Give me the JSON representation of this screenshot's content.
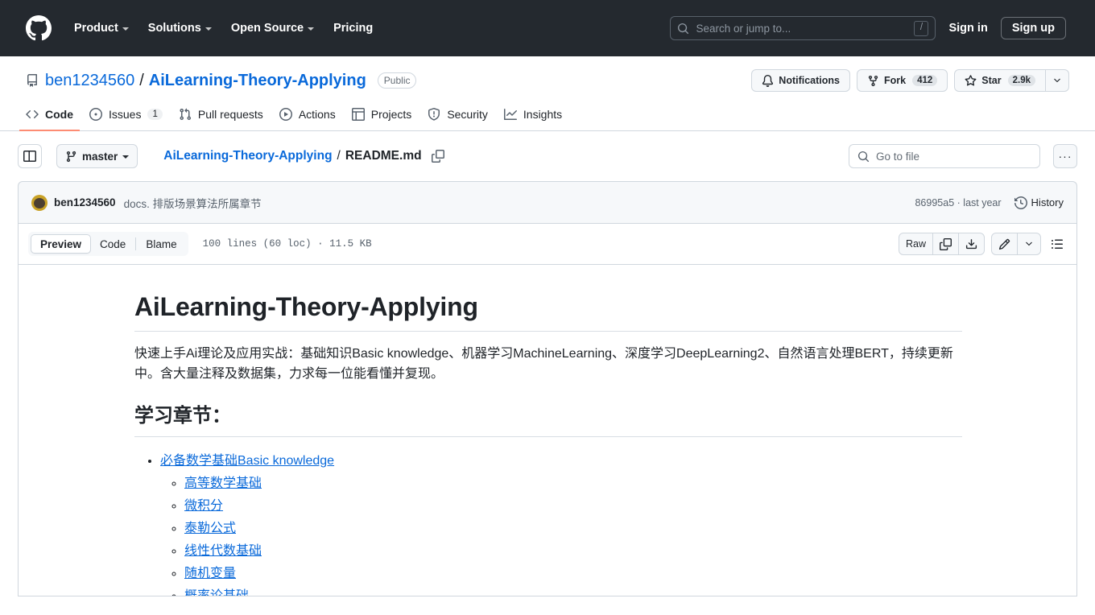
{
  "header": {
    "logo_icon": "github-mark-icon",
    "nav": [
      {
        "label": "Product",
        "has_chevron": true
      },
      {
        "label": "Solutions",
        "has_chevron": true
      },
      {
        "label": "Open Source",
        "has_chevron": true
      },
      {
        "label": "Pricing",
        "has_chevron": false
      }
    ],
    "search": {
      "placeholder": "Search or jump to...",
      "shortcut": "/",
      "icon": "search-icon"
    },
    "sign_in": "Sign in",
    "sign_up": "Sign up"
  },
  "repo": {
    "owner": "ben1234560",
    "separator": "/",
    "name": "AiLearning-Theory-Applying",
    "visibility": "Public",
    "repo_icon": "repo-icon",
    "actions": {
      "notifications": {
        "label": "Notifications",
        "icon": "bell-icon"
      },
      "fork": {
        "label": "Fork",
        "count": "412",
        "icon": "fork-icon"
      },
      "star": {
        "label": "Star",
        "count": "2.9k",
        "icon": "star-icon"
      },
      "star_dropdown_icon": "chevron-down-icon"
    },
    "tabs": [
      {
        "label": "Code",
        "icon": "code-icon",
        "active": true,
        "count": ""
      },
      {
        "label": "Issues",
        "icon": "issue-opened-icon",
        "active": false,
        "count": "1"
      },
      {
        "label": "Pull requests",
        "icon": "git-pull-request-icon",
        "active": false,
        "count": ""
      },
      {
        "label": "Actions",
        "icon": "play-icon",
        "active": false,
        "count": ""
      },
      {
        "label": "Projects",
        "icon": "table-icon",
        "active": false,
        "count": ""
      },
      {
        "label": "Security",
        "icon": "shield-icon",
        "active": false,
        "count": ""
      },
      {
        "label": "Insights",
        "icon": "graph-icon",
        "active": false,
        "count": ""
      }
    ]
  },
  "file_nav": {
    "sidebar_toggle_icon": "sidebar-expand-icon",
    "branch": "master",
    "branch_icon": "git-branch-icon",
    "breadcrumb_repo": "AiLearning-Theory-Applying",
    "breadcrumb_sep": "/",
    "breadcrumb_file": "README.md",
    "copy_path_icon": "copy-icon",
    "go_to_file_placeholder": "Go to file",
    "go_to_file_icon": "search-icon",
    "more_label": "···"
  },
  "commit": {
    "avatar": "user-avatar",
    "author": "ben1234560",
    "message": "docs. 排版场景算法所属章节",
    "sha": "86995a5",
    "sha_sep": "·",
    "relative_time": "last year",
    "history_label": "History",
    "history_icon": "history-icon"
  },
  "file_toolbar": {
    "views": [
      {
        "label": "Preview",
        "active": true
      },
      {
        "label": "Code",
        "active": false
      },
      {
        "label": "Blame",
        "active": false
      }
    ],
    "meta": "100 lines (60 loc) · 11.5 KB",
    "raw_label": "Raw",
    "copy_icon": "copy-icon",
    "download_icon": "download-icon",
    "edit_icon": "pencil-icon",
    "edit_dropdown_icon": "chevron-down-icon",
    "outline_icon": "list-unordered-icon"
  },
  "readme": {
    "h1": "AiLearning-Theory-Applying",
    "paragraph": "快速上手Ai理论及应用实战：基础知识Basic knowledge、机器学习MachineLearning、深度学习DeepLearning2、自然语言处理BERT，持续更新中。含大量注释及数据集，力求每一位能看懂并复现。",
    "h2": "学习章节：",
    "list": [
      {
        "label": "必备数学基础Basic knowledge",
        "children": [
          {
            "label": "高等数学基础"
          },
          {
            "label": "微积分"
          },
          {
            "label": "泰勒公式"
          },
          {
            "label": "线性代数基础"
          },
          {
            "label": "随机变量"
          },
          {
            "label": "概率论基础"
          }
        ]
      }
    ]
  },
  "colors": {
    "header_bg": "#24292f",
    "link": "#0969da",
    "active_tab_underline": "#fd8c73",
    "border": "#d0d7de",
    "muted_text": "#59636e"
  }
}
